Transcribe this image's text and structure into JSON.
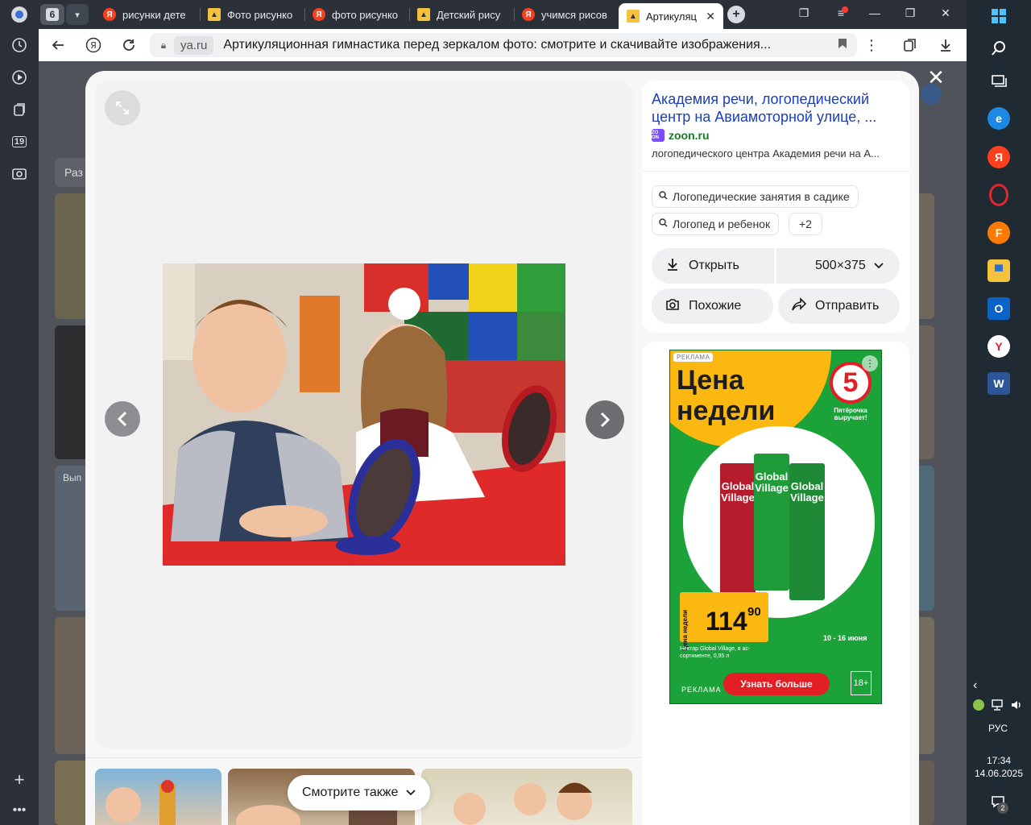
{
  "tabs": {
    "count": "6",
    "items": [
      {
        "label": "рисунки дете",
        "icon": "yandex-icon"
      },
      {
        "label": "Фото рисунко",
        "icon": "image-icon"
      },
      {
        "label": "фото рисунко",
        "icon": "yandex-icon"
      },
      {
        "label": "Детский рису",
        "icon": "image-icon"
      },
      {
        "label": "учимся рисов",
        "icon": "yandex-icon"
      },
      {
        "label": "Артикуляц",
        "icon": "image-icon",
        "active": true
      }
    ]
  },
  "address": {
    "domain": "ya.ru",
    "title": "Артикуляционная гимнастика перед зеркалом фото: смотрите и скачивайте изображения..."
  },
  "sidebar": {
    "calendar_day": "19"
  },
  "source": {
    "title": "Академия речи, логопедический центр на Авиамоторной улице, ...",
    "site": "zoon.ru",
    "site_badge": "ZO ON",
    "description": "логопедического центра Академия речи на А..."
  },
  "tags": [
    {
      "label": "Логопедические занятия в садике"
    },
    {
      "label": "Логопед и ребенок"
    },
    {
      "label": "+2"
    }
  ],
  "actions": {
    "open": "Открыть",
    "size": "500×375",
    "similar": "Похожие",
    "share": "Отправить"
  },
  "see_also": "Смотрите также",
  "ad": {
    "badge": "РЕКЛАМА",
    "headline_1": "Цена",
    "headline_2": "недели",
    "logo": "5",
    "slogan": "Пятёрочка выручает!",
    "pack_label": "Global Village",
    "price_tag": "Цена недели",
    "price_int": "114",
    "price_frac": "90",
    "dates": "10 - 16 июня",
    "product": "Нектар Global Village, в ас-сортименте, 0,95 л",
    "footer": "РЕКЛАМА",
    "cta": "Узнать больше",
    "age": "18+"
  },
  "page_bg": {
    "tab_fragment": "Раз",
    "label_fragment": "Вып"
  },
  "taskbar": {
    "lang": "РУС",
    "time": "17:34",
    "date": "14.06.2025",
    "notif_count": "2",
    "apps": [
      {
        "icon": "edge-icon",
        "color": "#1e88e5",
        "label": "e"
      },
      {
        "icon": "yandex-browser-icon",
        "color": "#fc3f1d",
        "label": "Я"
      },
      {
        "icon": "opera-icon",
        "color": "#e0262f",
        "label": "O"
      },
      {
        "icon": "firefox-icon",
        "color": "#ff7a00",
        "label": "F"
      },
      {
        "icon": "explorer-icon",
        "color": "#f5c23d",
        "label": "▀"
      },
      {
        "icon": "outlook-icon",
        "color": "#0a64c8",
        "label": "O"
      },
      {
        "icon": "yandex-icon",
        "color": "#ffffff",
        "label": "Y"
      },
      {
        "icon": "word-icon",
        "color": "#2b579a",
        "label": "W"
      }
    ]
  }
}
